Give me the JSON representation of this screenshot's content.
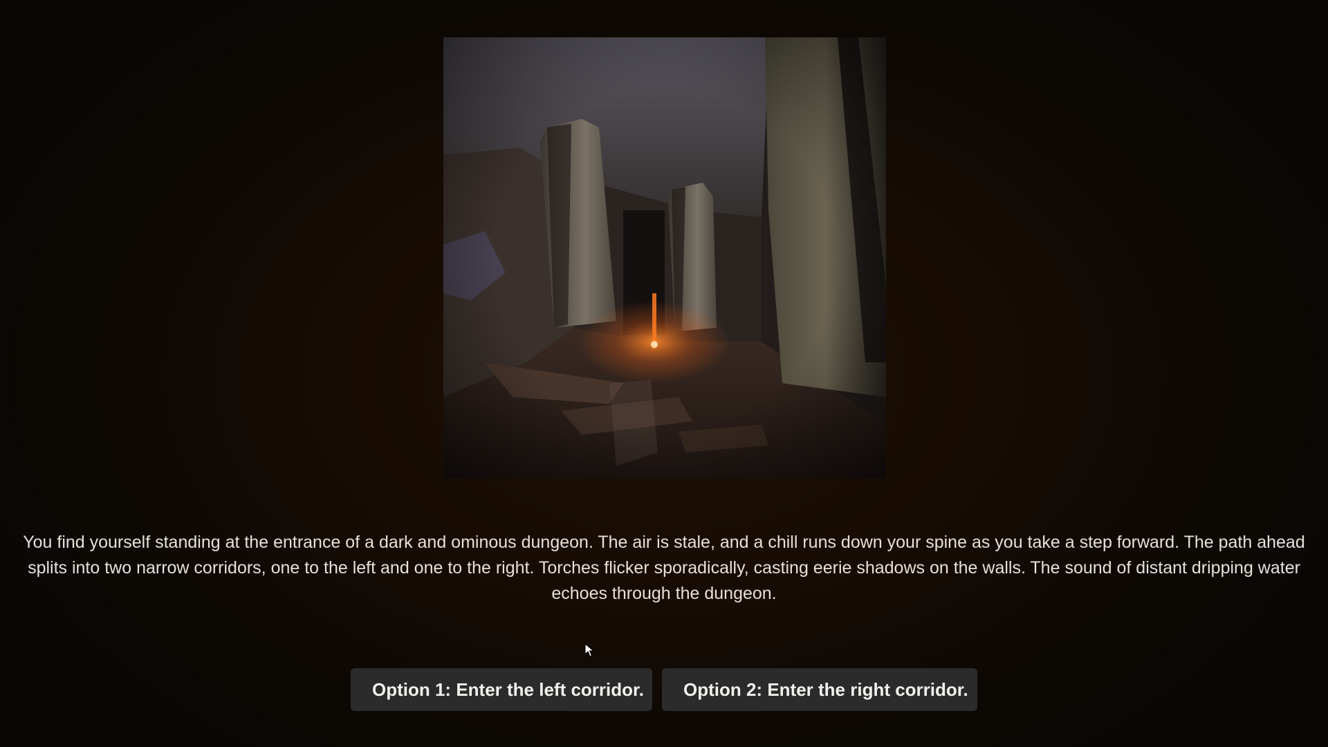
{
  "scene": {
    "image_icon": "dungeon-scene-illustration",
    "narrative": "You find yourself standing at the entrance of a dark and ominous dungeon. The air is stale, and a chill runs down your spine as you take a step forward. The path ahead splits into two narrow corridors, one to the left and one to the right. Torches flicker sporadically, casting eerie shadows on the walls. The sound of distant dripping water echoes through the dungeon."
  },
  "choices": [
    {
      "label": "Option 1: Enter the left corridor."
    },
    {
      "label": "Option 2: Enter the right corridor."
    }
  ],
  "colors": {
    "background": "#1a0e04",
    "button_bg": "#2b2b2b",
    "button_text": "#f2f0ec",
    "narrative_text": "#e6e1da"
  },
  "cursor_icon": "arrow-cursor-icon"
}
